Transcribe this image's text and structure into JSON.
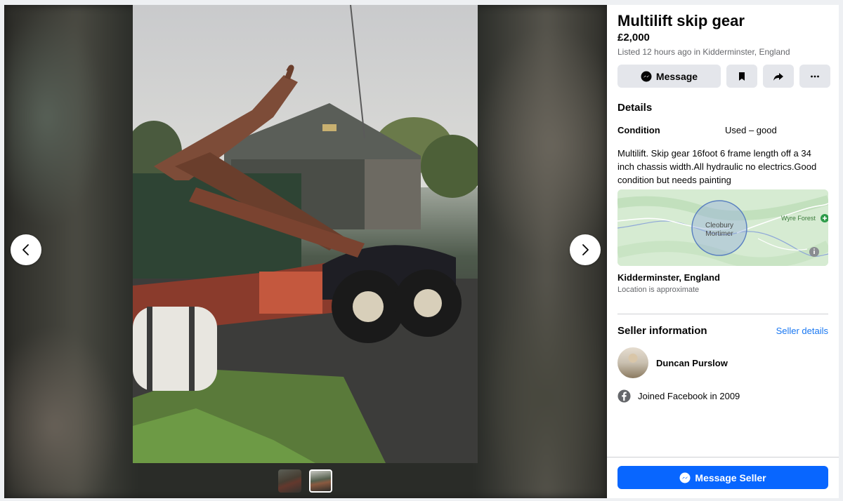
{
  "listing": {
    "title": "Multilift skip gear",
    "price": "£2,000",
    "listed": "Listed 12 hours ago in Kidderminster, England"
  },
  "actions": {
    "message_label": "Message",
    "icons": [
      "messenger-icon",
      "bookmark-icon",
      "share-icon",
      "more-icon"
    ]
  },
  "details": {
    "heading": "Details",
    "condition_label": "Condition",
    "condition_value": "Used – good",
    "description": "Multilift. Skip gear 16foot 6 frame length off a 34 inch chassis width.All hydraulic no electrics.Good condition but needs painting"
  },
  "map": {
    "place_label_1": "Cleobury",
    "place_label_2": "Mortimer",
    "poi_label": "Wyre Forest",
    "location": "Kidderminster, England",
    "location_note": "Location is approximate"
  },
  "seller": {
    "heading": "Seller information",
    "details_link": "Seller details",
    "name": "Duncan Purslow",
    "joined": "Joined Facebook in 2009"
  },
  "footer": {
    "message_seller_label": "Message Seller"
  },
  "colors": {
    "accent": "#0866ff",
    "link": "#1877f2",
    "secondary_text": "#65676b"
  }
}
